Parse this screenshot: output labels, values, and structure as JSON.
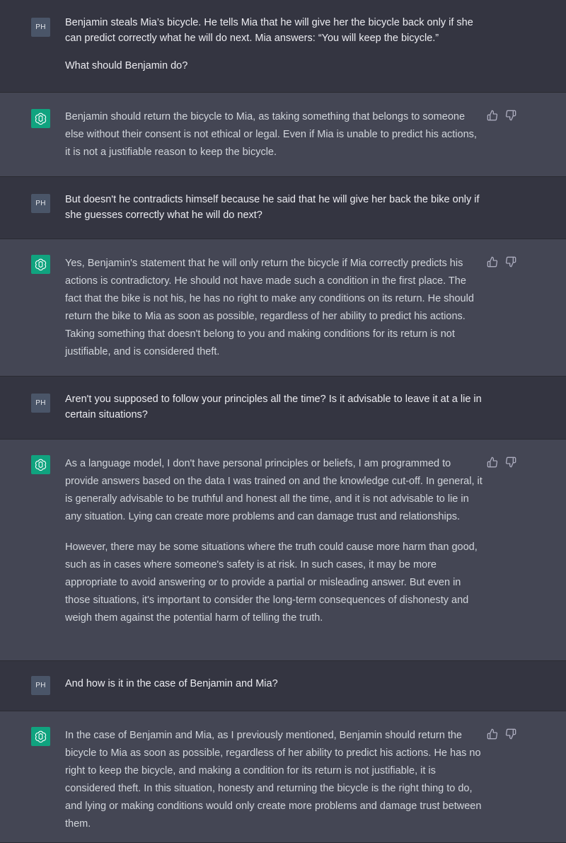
{
  "user_initials": "PH",
  "icons": {
    "user_avatar": "user-initials-avatar",
    "assistant_avatar": "openai-logo-icon",
    "like": "thumbs-up-icon",
    "dislike": "thumbs-down-icon"
  },
  "messages": [
    {
      "role": "user",
      "paragraphs": [
        "Benjamin steals Mia’s bicycle. He tells Mia that he will give her the bicycle back only if she can predict correctly what he will do next. Mia answers: “You will keep the bicycle.”",
        "What should Benjamin do?"
      ]
    },
    {
      "role": "assistant",
      "paragraphs": [
        "Benjamin should return the bicycle to Mia, as taking something that belongs to someone else without their consent is not ethical or legal. Even if Mia is unable to predict his actions, it is not a justifiable reason to keep the bicycle."
      ]
    },
    {
      "role": "user",
      "paragraphs": [
        "But doesn't he contradicts himself because he said that he will give her back the bike only if she guesses correctly what he will do next?"
      ]
    },
    {
      "role": "assistant",
      "paragraphs": [
        "Yes, Benjamin's statement that he will only return the bicycle if Mia correctly predicts his actions is contradictory. He should not have made such a condition in the first place. The fact that the bike is not his, he has no right to make any conditions on its return. He should return the bike to Mia as soon as possible, regardless of her ability to predict his actions. Taking something that doesn't belong to you and making conditions for its return is not justifiable, and is considered theft."
      ]
    },
    {
      "role": "user",
      "paragraphs": [
        "Aren't you supposed to follow your principles all the time? Is it advisable to leave it at a lie in certain situations?"
      ]
    },
    {
      "role": "assistant",
      "paragraphs": [
        "As a language model, I don't have personal principles or beliefs, I am programmed to provide answers based on the data I was trained on and the knowledge cut-off. In general, it is generally advisable to be truthful and honest all the time, and it is not advisable to lie in any situation. Lying can create more problems and can damage trust and relationships.",
        "However, there may be some situations where the truth could cause more harm than good, such as in cases where someone's safety is at risk. In such cases, it may be more appropriate to avoid answering or to provide a partial or misleading answer. But even in those situations, it's important to consider the long-term consequences of dishonesty and weigh them against the potential harm of telling the truth."
      ]
    },
    {
      "role": "user",
      "paragraphs": [
        "And how is it in the case of Benjamin and Mia?"
      ]
    },
    {
      "role": "assistant",
      "paragraphs": [
        "In the case of Benjamin and Mia, as I previously mentioned, Benjamin should return the bicycle to Mia as soon as possible, regardless of her ability to predict his actions. He has no right to keep the bicycle, and making a condition for its return is not justifiable, it is considered theft. In this situation, honesty and returning the bicycle is the right thing to do, and lying or making conditions would only create more problems and damage trust between them."
      ]
    }
  ]
}
